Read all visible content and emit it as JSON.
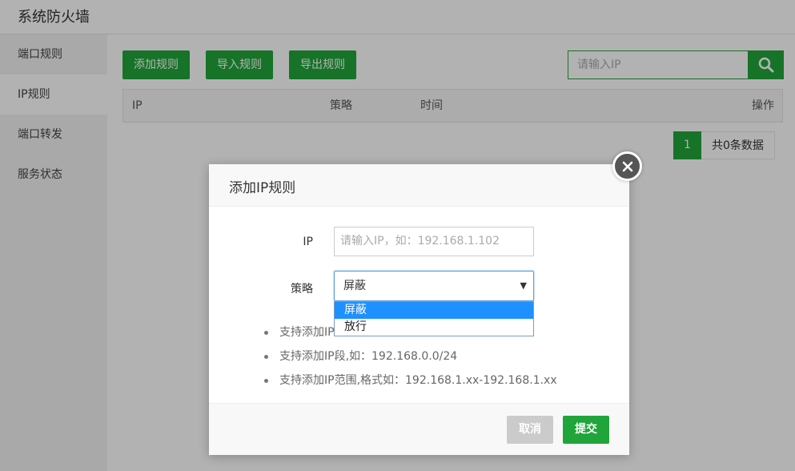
{
  "app": {
    "title": "系统防火墙"
  },
  "sidebar": {
    "items": [
      {
        "label": "端口规则"
      },
      {
        "label": "IP规则"
      },
      {
        "label": "端口转发"
      },
      {
        "label": "服务状态"
      }
    ]
  },
  "toolbar": {
    "add_label": "添加规则",
    "import_label": "导入规则",
    "export_label": "导出规则",
    "search_placeholder": "请输入IP"
  },
  "table": {
    "columns": [
      "IP",
      "策略",
      "时间",
      "操作"
    ],
    "rows": []
  },
  "pager": {
    "page": "1",
    "info": "共0条数据"
  },
  "modal": {
    "title": "添加IP规则",
    "ip_label": "IP",
    "ip_placeholder": "请输入IP，如：192.168.1.102",
    "policy_label": "策略",
    "policy_value": "屏蔽",
    "policy_options": [
      "屏蔽",
      "放行"
    ],
    "tips": [
      "支持添加IP",
      "支持添加IP段,如：192.168.0.0/24",
      "支持添加IP范围,格式如：192.168.1.xx-192.168.1.xx"
    ],
    "cancel_label": "取消",
    "submit_label": "提交"
  },
  "colors": {
    "accent": "#20a53a",
    "select_highlight": "#1e90ff"
  }
}
